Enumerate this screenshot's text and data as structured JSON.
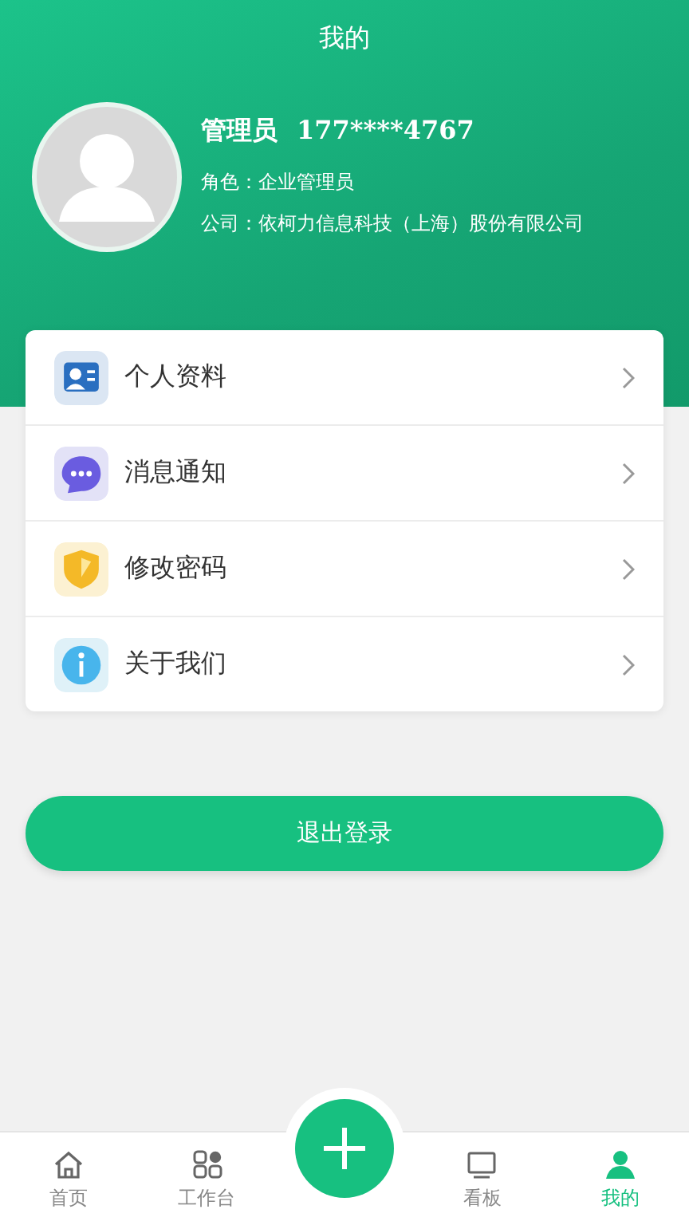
{
  "header": {
    "title": "我的"
  },
  "profile": {
    "name": "管理员",
    "phone": "177****4767",
    "role": "角色：企业管理员",
    "company": "公司：依柯力信息科技（上海）股份有限公司"
  },
  "menu": [
    {
      "kind": "profile",
      "label": "个人资料"
    },
    {
      "kind": "message",
      "label": "消息通知"
    },
    {
      "kind": "password",
      "label": "修改密码"
    },
    {
      "kind": "about",
      "label": "关于我们"
    }
  ],
  "logout": {
    "label": "退出登录"
  },
  "tabs": [
    {
      "kind": "home",
      "label": "首页",
      "selected": false
    },
    {
      "kind": "workbench",
      "label": "工作台",
      "selected": false
    },
    {
      "kind": "add",
      "selected": false
    },
    {
      "kind": "board",
      "label": "看板",
      "selected": false
    },
    {
      "kind": "mine",
      "label": "我的",
      "selected": true
    }
  ]
}
